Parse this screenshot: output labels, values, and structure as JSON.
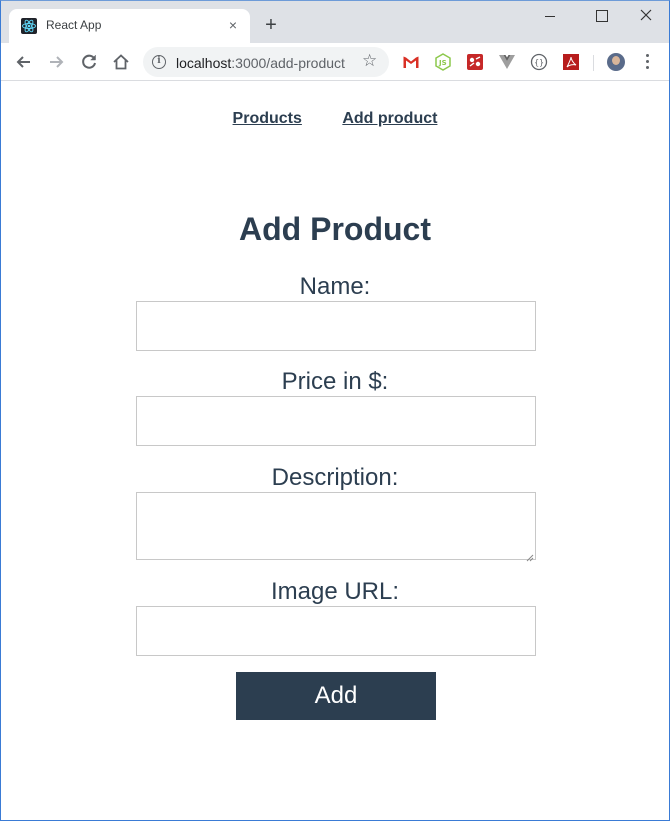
{
  "browser": {
    "tab": {
      "title": "React App",
      "favicon": "react-icon",
      "close": "×"
    },
    "new_tab": "+",
    "address": {
      "host": "localhost",
      "path": ":3000/add-product"
    },
    "extensions": [
      "gmail-icon",
      "nodejs-icon",
      "red-extension-icon",
      "vue-devtools-icon",
      "json-viewer-icon",
      "pdf-icon"
    ]
  },
  "nav": {
    "products": "Products",
    "add_product": "Add product"
  },
  "form": {
    "title": "Add Product",
    "name_label": "Name:",
    "price_label": "Price in $:",
    "description_label": "Description:",
    "image_label": "Image URL:",
    "name_value": "",
    "price_value": "",
    "description_value": "",
    "image_value": "",
    "submit_label": "Add"
  },
  "colors": {
    "text": "#2c3e50",
    "button_bg": "#2c3e50",
    "button_text": "#ffffff",
    "tabstrip": "#dee1e6"
  }
}
